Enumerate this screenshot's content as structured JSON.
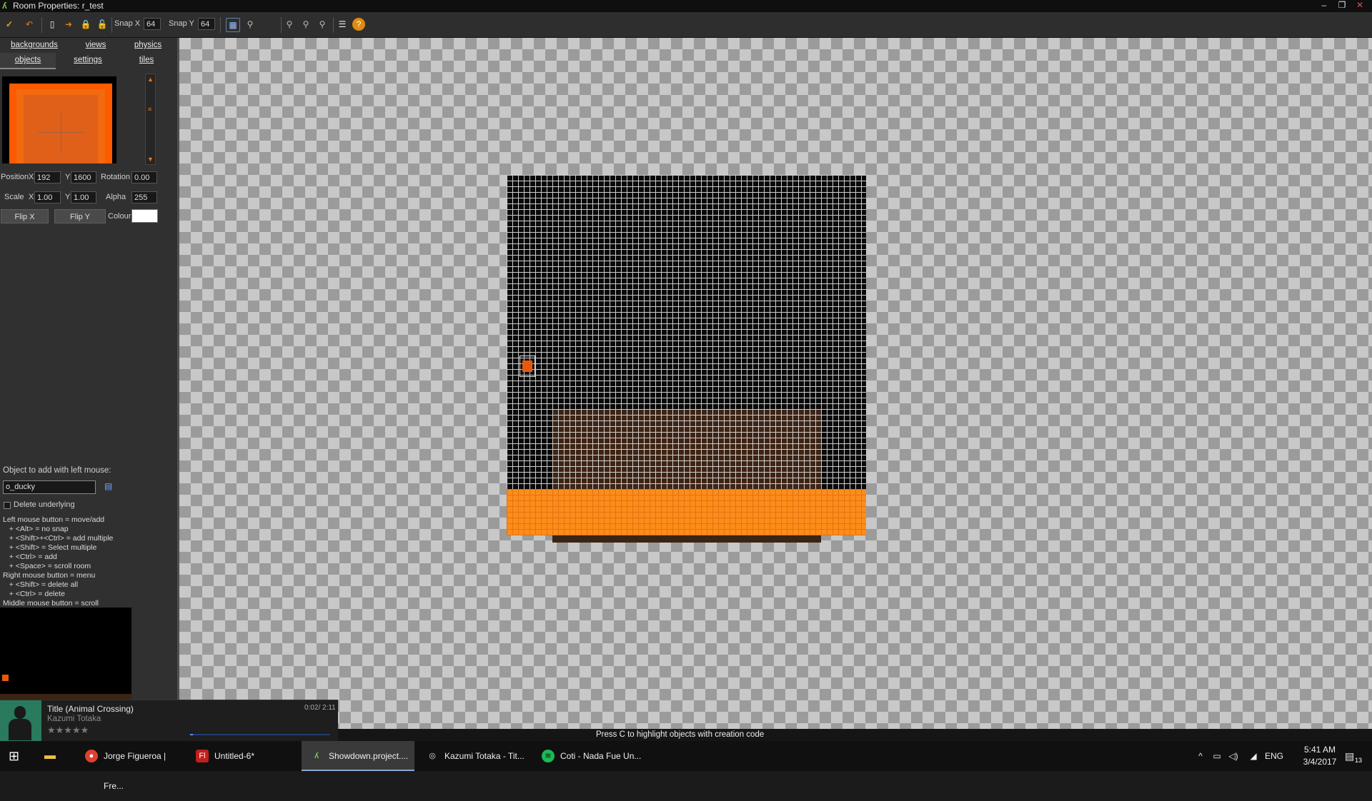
{
  "window": {
    "title": "Room Properties: r_test",
    "minimize": "–",
    "maximize": "❐",
    "close": "✕"
  },
  "toolbar": {
    "snap_x_label": "Snap X",
    "snap_x_value": "64",
    "snap_y_label": "Snap Y",
    "snap_y_value": "64"
  },
  "tabs": {
    "row1": [
      "backgrounds",
      "views",
      "physics"
    ],
    "row2": [
      "objects",
      "settings",
      "tiles"
    ]
  },
  "instance": {
    "position_label": "Position",
    "x_label": "X",
    "x_value": "192",
    "y_label": "Y",
    "y_value": "1600",
    "rotation_label": "Rotation",
    "rotation_value": "0.00",
    "scale_label": "Scale",
    "scale_x_label": "X",
    "scale_x_value": "1.00",
    "scale_y_label": "Y",
    "scale_y_value": "1.00",
    "alpha_label": "Alpha",
    "alpha_value": "255",
    "flip_x": "Flip X",
    "flip_y": "Flip Y",
    "colour_label": "Colour",
    "colour_value": "#ffffff"
  },
  "object_picker": {
    "label": "Object to add with left mouse:",
    "value": "o_ducky",
    "delete_underlying": "Delete underlying"
  },
  "help": [
    "Left mouse button = move/add",
    "   + <Alt> = no snap",
    "   + <Shift>+<Ctrl> = add multiple",
    "   + <Shift> = Select multiple",
    "   + <Ctrl> = add",
    "   + <Space> = scroll room",
    "Right mouse button = menu",
    "   + <Shift> = delete all",
    "   + <Ctrl> = delete",
    "Middle mouse button = scroll"
  ],
  "status": "Press C to highlight objects with creation code",
  "music": {
    "title": "Title (Animal Crossing)",
    "artist": "Kazumi Totaka",
    "time": "0:02/ 2:11",
    "rating_stars": "★★★★★",
    "progress": 0.02
  },
  "taskbar": {
    "items": [
      {
        "label": "Jorge Figueroa | Fre...",
        "icon": "chrome-icon"
      },
      {
        "label": "Untitled-6*",
        "icon": "flash-icon"
      },
      {
        "label": "Showdown.project....",
        "icon": "gamemaker-icon"
      },
      {
        "label": "Kazumi Totaka - Tit...",
        "icon": "music-player-icon"
      },
      {
        "label": "Coti - Nada Fue Un...",
        "icon": "spotify-icon"
      }
    ],
    "language": "ENG",
    "time": "5:41 AM",
    "date": "3/4/2017",
    "notifications": "13"
  },
  "colors": {
    "accent_orange": "#ff8c1a",
    "room_bg": "#0a0a0a",
    "brown_tiles": "#3e2414"
  }
}
